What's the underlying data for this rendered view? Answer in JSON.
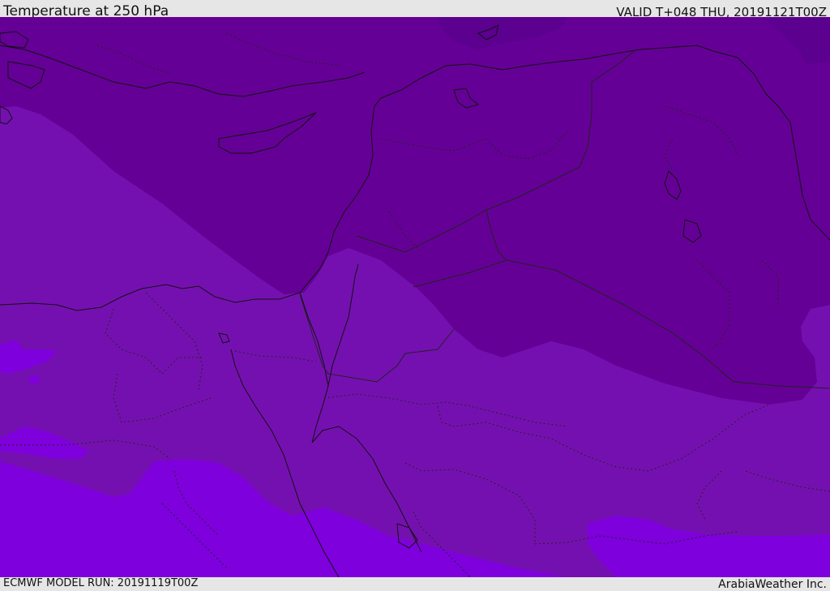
{
  "header": {
    "title": "Temperature at 250 hPa",
    "valid": "VALID T+048 THU, 20191121T00Z"
  },
  "footer": {
    "model_run": "ECMWF MODEL RUN: 20191119T00Z",
    "credit": "ArabiaWeather Inc."
  },
  "colors": {
    "band_darkest": "#5c0090",
    "band_dark": "#650096",
    "band_mid": "#7510b0",
    "band_light": "#7e00dd",
    "coast_line": "#111111",
    "border_line": "#222222"
  },
  "icons": {
    "map": "temperature-shaded-map"
  }
}
